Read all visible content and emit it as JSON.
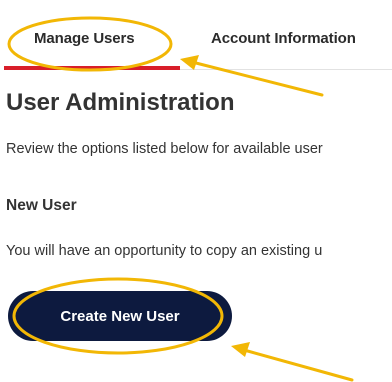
{
  "tabs": [
    {
      "label": "Manage Users",
      "active": true
    },
    {
      "label": "Account Information",
      "active": false
    }
  ],
  "page": {
    "title": "User Administration",
    "intro": "Review the options listed below for available user"
  },
  "new_user": {
    "heading": "New User",
    "description": "You will have an opportunity to copy an existing u",
    "button_label": "Create New User"
  },
  "colors": {
    "tab_underline": "#d81e2a",
    "button_bg": "#0d1a3f",
    "annotation": "#f2b705"
  },
  "annotations": [
    {
      "type": "circle",
      "target": "tab-manage-users"
    },
    {
      "type": "arrow",
      "target": "tab-manage-users"
    },
    {
      "type": "circle",
      "target": "create-new-user-button"
    },
    {
      "type": "arrow",
      "target": "create-new-user-button"
    }
  ]
}
